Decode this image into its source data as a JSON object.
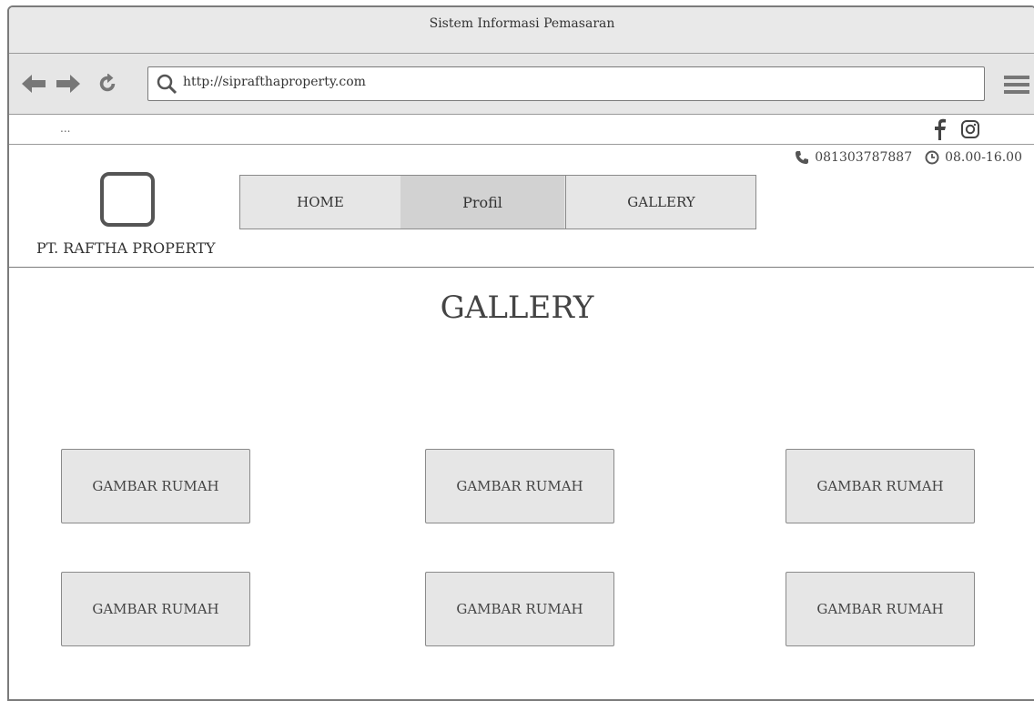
{
  "window": {
    "title": "Sistem Informasi Pemasaran"
  },
  "browser": {
    "url": "http://siprafthaproperty.com"
  },
  "topbar": {
    "dots": "..."
  },
  "contact": {
    "phone": "081303787887",
    "hours": "08.00-16.00"
  },
  "brand": {
    "company": "PT. RAFTHA PROPERTY"
  },
  "nav": {
    "home": "HOME",
    "profil": "Profil",
    "gallery": "GALLERY"
  },
  "page": {
    "title": "GALLERY"
  },
  "gallery": {
    "items": [
      {
        "label": "GAMBAR RUMAH"
      },
      {
        "label": "GAMBAR RUMAH"
      },
      {
        "label": "GAMBAR RUMAH"
      },
      {
        "label": "GAMBAR RUMAH"
      },
      {
        "label": "GAMBAR RUMAH"
      },
      {
        "label": "GAMBAR RUMAH"
      }
    ]
  },
  "icons": {
    "back": "back-arrow-icon",
    "forward": "forward-arrow-icon",
    "reload": "reload-icon",
    "search": "search-icon",
    "menu": "hamburger-menu-icon",
    "facebook": "facebook-icon",
    "instagram": "instagram-icon",
    "phone": "phone-icon",
    "clock": "clock-icon"
  },
  "colors": {
    "chrome": "#e6e6e6",
    "border": "#7b7b7b",
    "active_tab": "#d2d2d2"
  }
}
